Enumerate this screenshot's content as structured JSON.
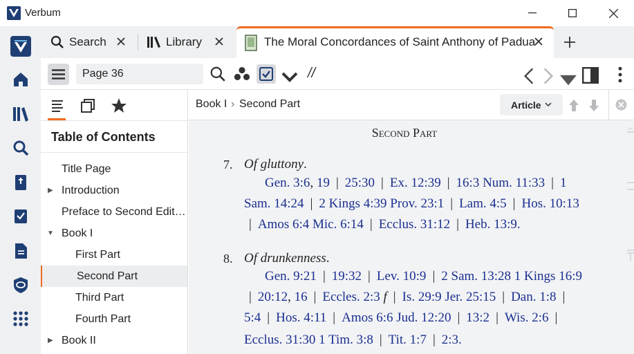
{
  "window": {
    "title": "Verbum"
  },
  "tabs": [
    {
      "label": "Search",
      "icon": "search-icon"
    },
    {
      "label": "Library",
      "icon": "library-icon"
    },
    {
      "label": "The Moral Concordances of Saint Anthony of Padua",
      "icon": "book-icon",
      "active": true
    }
  ],
  "toolbar": {
    "page_value": "Page 36",
    "parallel_label": "//"
  },
  "sidepanel": {
    "title": "Table of Contents",
    "toc": [
      {
        "label": "Title Page"
      },
      {
        "label": "Introduction"
      },
      {
        "label": "Preface to Second Edit…"
      },
      {
        "label": "Book I"
      },
      {
        "label": "First Part"
      },
      {
        "label": "Second Part"
      },
      {
        "label": "Third Part"
      },
      {
        "label": "Fourth Part"
      },
      {
        "label": "Book II"
      }
    ]
  },
  "breadcrumb": {
    "part1": "Book I",
    "sep": "›",
    "part2": "Second Part"
  },
  "article_btn": {
    "label": "Article"
  },
  "content": {
    "heading": "Second Part",
    "entry7": {
      "num": "7.",
      "title": "Of gluttony",
      "punct": ".",
      "l1": {
        "a": "Gen. 3:6",
        "b": ", ",
        "c": "19",
        "d": "25:30",
        "e": "Ex. 12:39",
        "f": "16:3 Num. 11:33",
        "g": "1"
      },
      "l2": {
        "a": "Sam. 14:24",
        "b": "2 Kings 4:39 Prov. 23:1",
        "c": "Lam. 4:5",
        "d": "Hos. 10:13"
      },
      "l3": {
        "a": "Amos 6:4 Mic. 6:14",
        "b": "Ecclus. 31:12",
        "c": "Heb. 13:9",
        "d": "."
      }
    },
    "entry8": {
      "num": "8.",
      "title": "Of drunkenness",
      "punct": ".",
      "l1": {
        "a": "Gen. 9:21",
        "b": "19:32",
        "c": "Lev. 10:9",
        "d": "2 Sam. 13:28 1 Kings 16:9"
      },
      "l2": {
        "a": "20:12",
        "b": ", ",
        "c": "16",
        "d": "Eccles. 2:3",
        "e": " f",
        "f": "Is. 29:9 Jer. 25:15",
        "g": "Dan. 1:8"
      },
      "l3": {
        "a": "5:4",
        "b": "Hos. 4:11",
        "c": "Amos 6:6 Jud. 12:20",
        "d": "13:2",
        "e": "Wis. 2:6"
      },
      "l4": {
        "a": "Ecclus. 31:30 1 Tim. 3:8",
        "b": "Tit. 1:7",
        "c": "2:3",
        "d": "."
      }
    }
  },
  "colors": {
    "accent": "#ef6b1f",
    "brand": "#1f3f74",
    "link": "#1a2f8f"
  }
}
